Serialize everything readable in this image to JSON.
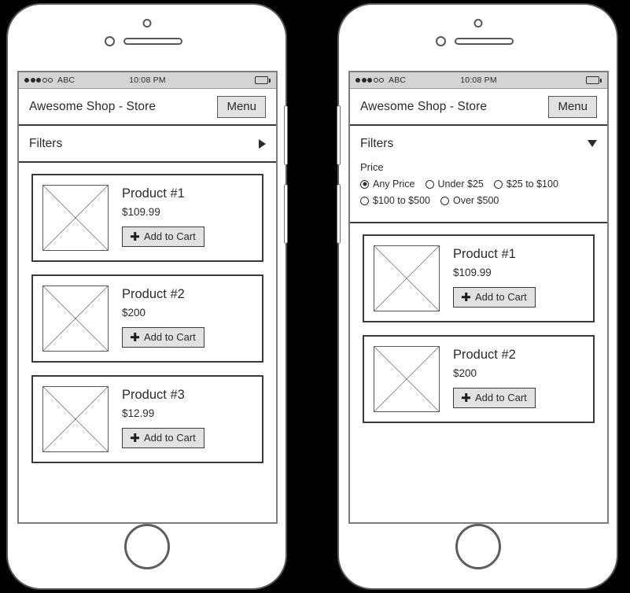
{
  "statusbar": {
    "signal_filled": 3,
    "signal_empty": 2,
    "carrier": "ABC",
    "time": "10:08 PM",
    "battery_icon": "battery-icon"
  },
  "header": {
    "title": "Awesome Shop - Store",
    "menu_label": "Menu"
  },
  "filters": {
    "label": "Filters",
    "collapsed_icon": "triangle-right-icon",
    "expanded_icon": "triangle-down-icon",
    "group_label": "Price",
    "options_row1": [
      {
        "label": "Any Price",
        "selected": true
      },
      {
        "label": "Under $25",
        "selected": false
      },
      {
        "label": "$25 to $100",
        "selected": false
      }
    ],
    "options_row2": [
      {
        "label": "$100 to $500",
        "selected": false
      },
      {
        "label": "Over $500",
        "selected": false
      }
    ]
  },
  "cart_button_label": "Add to Cart",
  "products_left": [
    {
      "name": "Product #1",
      "price": "$109.99"
    },
    {
      "name": "Product #2",
      "price": "$200"
    },
    {
      "name": "Product #3",
      "price": "$12.99"
    }
  ],
  "products_right": [
    {
      "name": "Product #1",
      "price": "$109.99"
    },
    {
      "name": "Product #2",
      "price": "$200"
    }
  ],
  "colors": {
    "page_background": "#000000",
    "phone_body": "#ffffff",
    "phone_outline": "#58585a",
    "statusbar_bg": "#d4d4d4",
    "text": "#2b2b2b",
    "button_bg": "#e2e2e2",
    "border": "#3a3a3a"
  }
}
